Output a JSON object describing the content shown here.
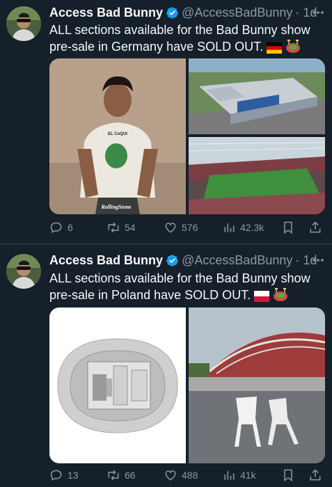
{
  "tweets": [
    {
      "name": "Access Bad Bunny",
      "handle": "@AccessBadBunny",
      "time": "· 1d",
      "text": "ALL sections available for the Bad Bunny show pre-sale in Germany have SOLD OUT.",
      "flag_icon": "germany-flag-icon",
      "stadium_icon": "stadium-emoji-icon",
      "image_caption": "RollingStone",
      "shirt_text": "EL CoQUI",
      "counts": {
        "replies": "6",
        "reposts": "54",
        "likes": "576",
        "views": "42.3k"
      }
    },
    {
      "name": "Access Bad Bunny",
      "handle": "@AccessBadBunny",
      "time": "· 1d",
      "text": "ALL sections available for the Bad Bunny show pre-sale in Poland have SOLD OUT.",
      "flag_icon": "poland-flag-icon",
      "stadium_icon": "stadium-emoji-icon",
      "counts": {
        "replies": "13",
        "reposts": "66",
        "likes": "488",
        "views": "41k"
      }
    }
  ],
  "colors": {
    "background": "#15202b",
    "text": "#f7f9f9",
    "muted": "#8b98a5",
    "verified": "#1d9bf0",
    "divider": "#38444d"
  }
}
